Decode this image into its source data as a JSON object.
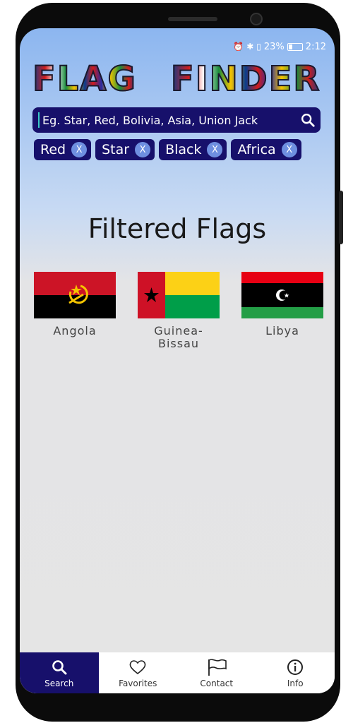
{
  "status_bar": {
    "battery": "23%",
    "time": "2:12",
    "icons": [
      "alarm-icon",
      "bluetooth-icon",
      "vibrate-icon",
      "battery-icon"
    ]
  },
  "app": {
    "logo_word_1": "FLAG",
    "logo_word_2": "FINDER"
  },
  "search": {
    "placeholder": "Eg. Star, Red, Bolivia, Asia, Union Jack",
    "value": "",
    "icon": "search-icon"
  },
  "filters": [
    {
      "label": "Red",
      "remove": "X"
    },
    {
      "label": "Star",
      "remove": "X"
    },
    {
      "label": "Black",
      "remove": "X"
    },
    {
      "label": "Africa",
      "remove": "X"
    }
  ],
  "section_title": "Filtered Flags",
  "results": [
    {
      "name": "Angola"
    },
    {
      "name": "Guinea-\nBissau"
    },
    {
      "name": "Libya"
    }
  ],
  "colors": {
    "primary": "#17106b",
    "chip_x": "#6e8fe0",
    "angola_red": "#cc1426",
    "gb_red": "#ce1126",
    "gb_yellow": "#fcd116",
    "gb_green": "#009e49",
    "libya_green": "#239e46"
  },
  "nav": [
    {
      "label": "Search",
      "icon": "search-icon",
      "active": true
    },
    {
      "label": "Favorites",
      "icon": "heart-icon",
      "active": false
    },
    {
      "label": "Contact",
      "icon": "flag-icon",
      "active": false
    },
    {
      "label": "Info",
      "icon": "info-icon",
      "active": false
    }
  ]
}
